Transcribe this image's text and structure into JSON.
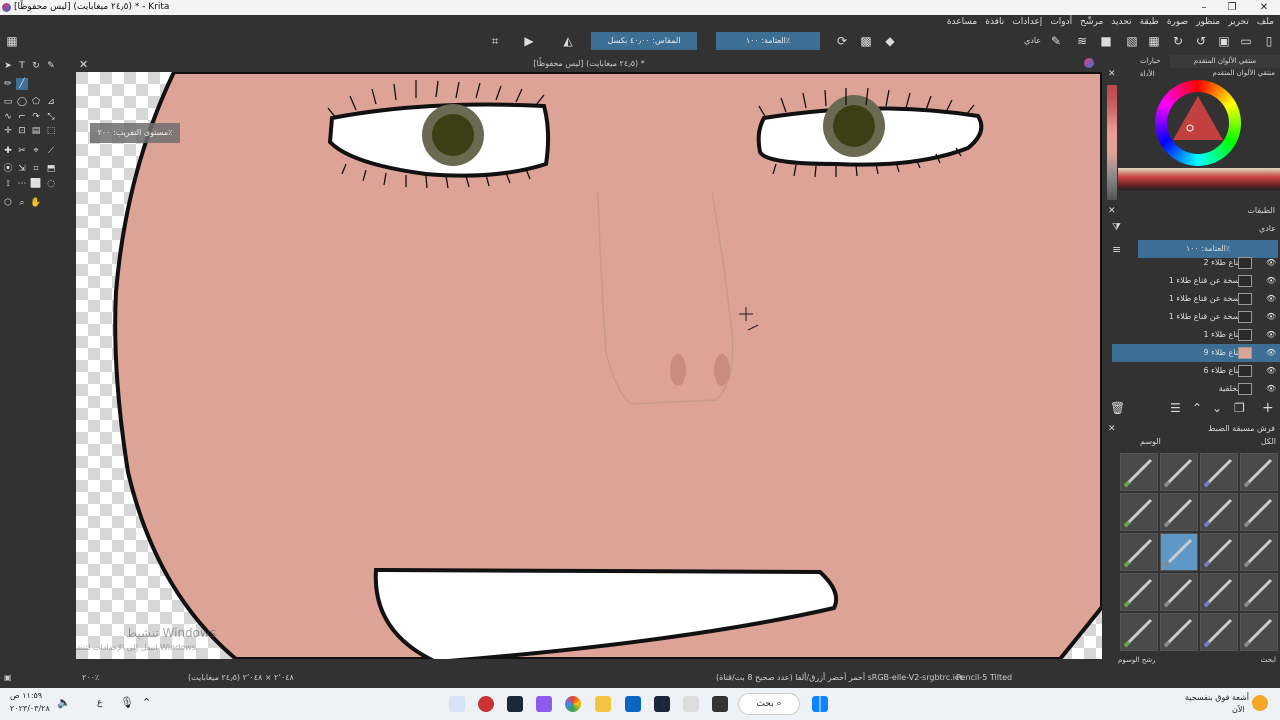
{
  "window": {
    "title": "[ليس محفوظًا]  (٢٤٫٥ ميغابايت) * - Krita"
  },
  "menu": [
    "ملف",
    "تحرير",
    "منظور",
    "صورة",
    "طبقة",
    "تحديد",
    "مرشّح",
    "أدوات",
    "إعدادات",
    "نافذة",
    "مساعدة"
  ],
  "toolbar": {
    "opacity_label": "العتامة: ١٠٠٪",
    "size_label": "المقاس: ٤٠٫٠٠ بكسل",
    "blend_mode": "عادي"
  },
  "document": {
    "tab_title": "[ليس محفوظًا]  (٢٤٫٥ ميغابايت) *",
    "zoom_tooltip": "مستوى التقريب: ٢٠٠٪",
    "watermark_line1": "تنشيط Windows",
    "watermark_line2": "انتقل إلى الإعدادات لتنشيط Windows."
  },
  "right_panel": {
    "tab_colors": "منتقي الألوان المتقدم",
    "tab_tool_options": "خيارات الأداة",
    "colors_title": "منتقي الألوان المتقدم",
    "layers_title": "الطبقات",
    "layers_blend": "عادي",
    "layers_opacity": "العتامة: ١٠٠٪",
    "brushes_title": "فرش مسبقة الضبط",
    "brushes_tag": "الكل",
    "brushes_search_label": "الوسم",
    "brushes_filter": "ابحث",
    "brushes_tag_check": "رشح الوسوم"
  },
  "layers": [
    {
      "name": "قناع طلاء 2",
      "active": false
    },
    {
      "name": "نسخة عن قناع طلاء 1",
      "active": false
    },
    {
      "name": "نسخة عن قناع طلاء 1",
      "active": false
    },
    {
      "name": "نسخة عن قناع طلاء 1",
      "active": false
    },
    {
      "name": "قناع طلاء 1",
      "active": false
    },
    {
      "name": "قناع طلاء 9",
      "active": true
    },
    {
      "name": "قناع طلاء 6",
      "active": false
    },
    {
      "name": "الخلفية",
      "active": false
    }
  ],
  "status": {
    "brush": "Pencil-5 Tilted",
    "color_info": "أحمر أخضر أزرق/ألفا (عدد صحيح 8 بت/قناة)  sRGB-elle-V2-srgbtrc.icc",
    "dimensions": "٢٬٠٤٨ × ٢٬٠٤٨ (٢٤٫٥ ميغابايت)",
    "zoom": "٢٠٠٪"
  },
  "taskbar": {
    "search": "بحث",
    "weather": "أشعة فوق بنفسجية",
    "weather_sub": "الآن",
    "time": "١١:٥٩ ص",
    "date": "٢٠٢٣/٠٣/٢٨",
    "lang": "ع"
  },
  "colors": {
    "accent": "#3d6f95",
    "skin": "#dea397",
    "eye_iris": "#3b3f14",
    "selected_layer": "#3d6f95"
  }
}
